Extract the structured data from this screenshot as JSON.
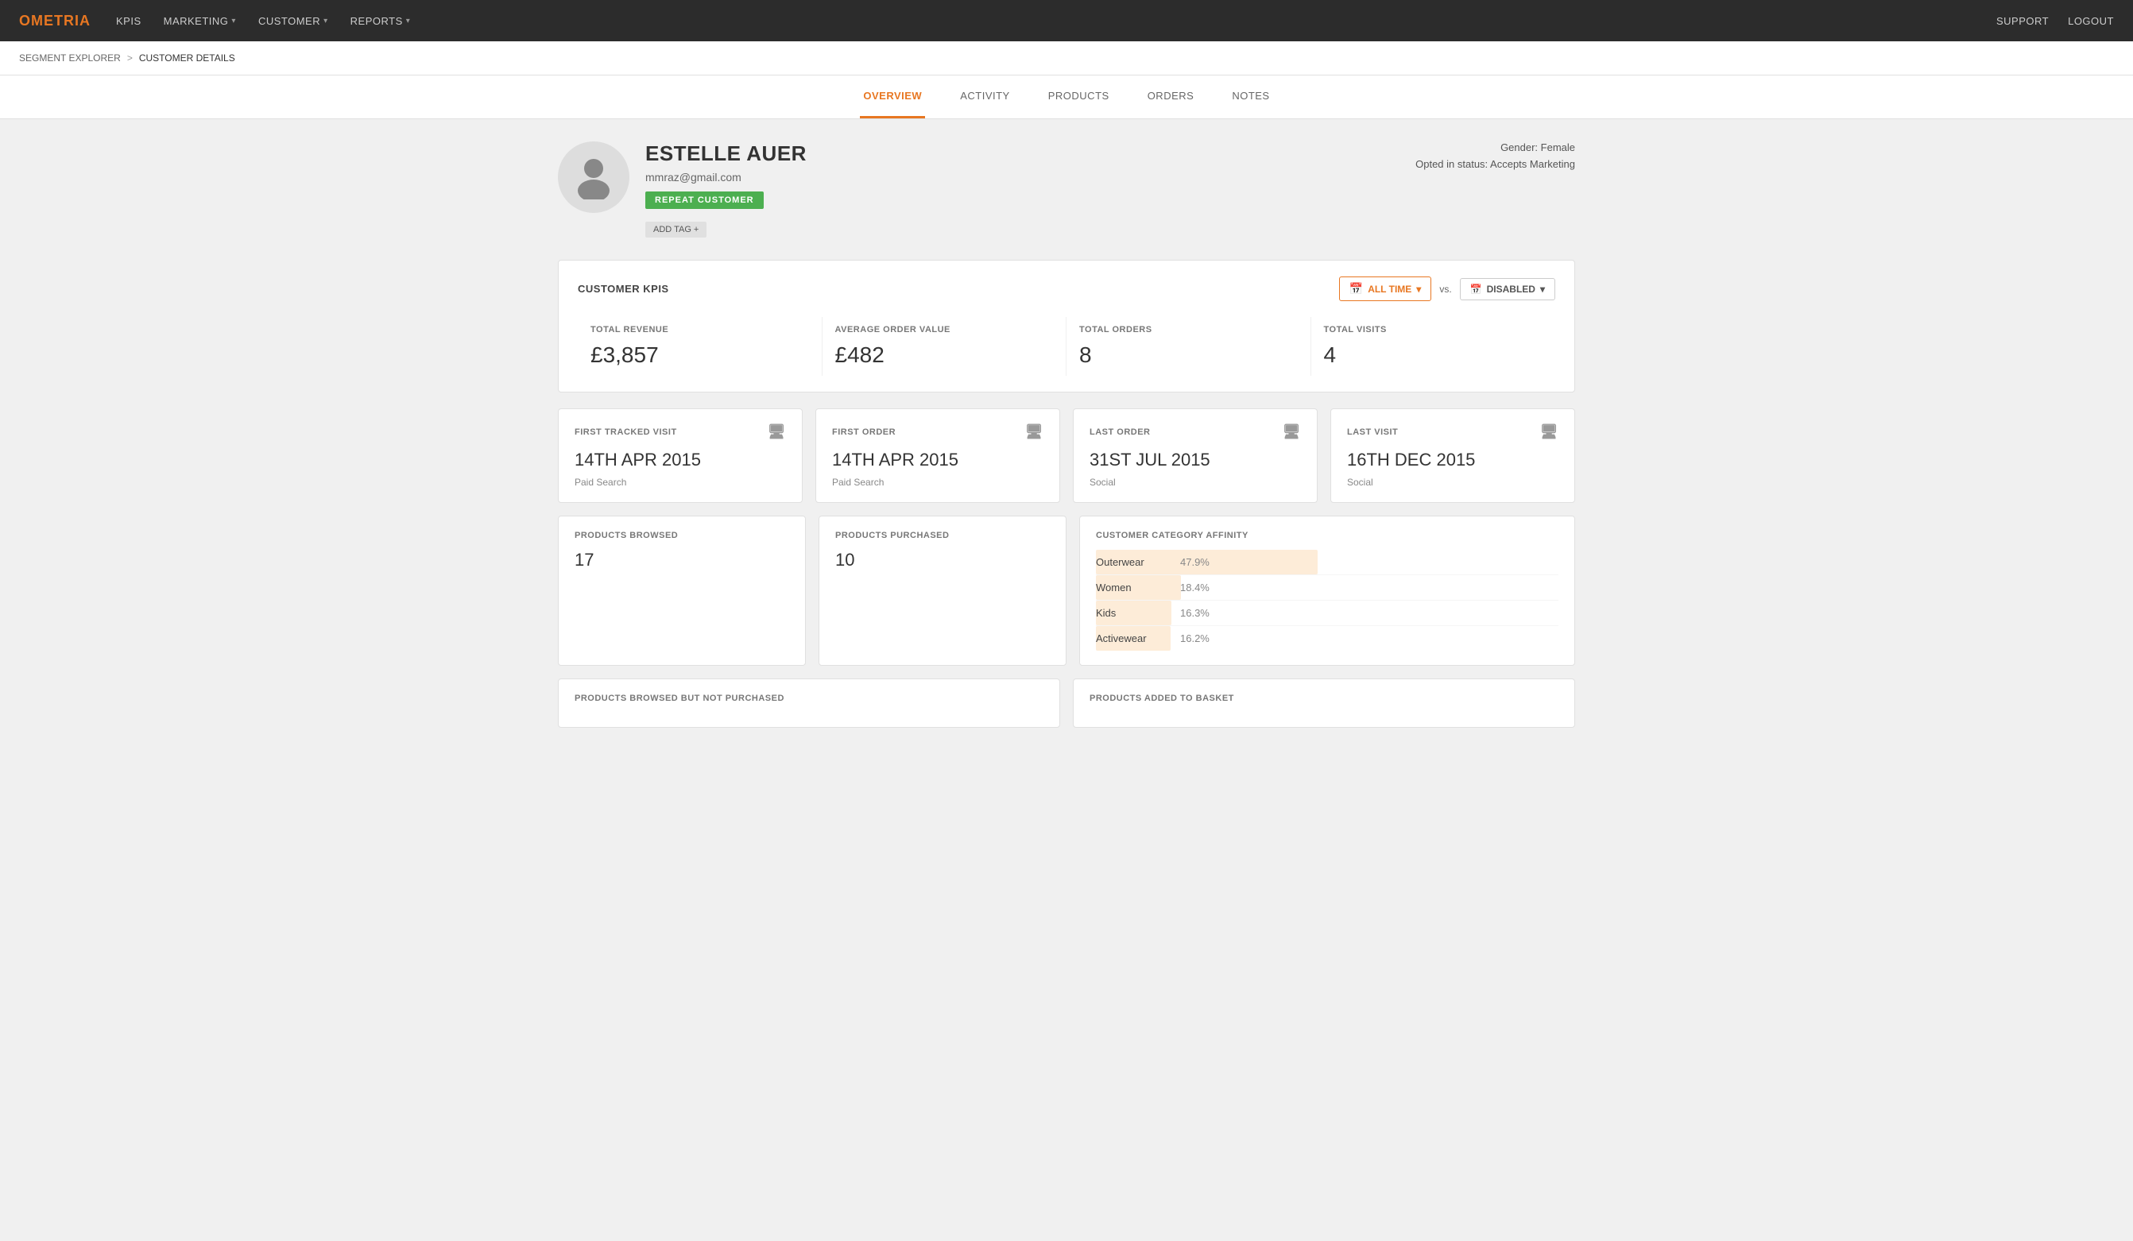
{
  "nav": {
    "logo": "OMETRIA",
    "items": [
      {
        "label": "KPIS",
        "hasDropdown": false
      },
      {
        "label": "MARKETING",
        "hasDropdown": true
      },
      {
        "label": "CUSTOMER",
        "hasDropdown": true
      },
      {
        "label": "REPORTS",
        "hasDropdown": true
      }
    ],
    "right_items": [
      {
        "label": "SUPPORT"
      },
      {
        "label": "LOGOUT"
      }
    ]
  },
  "breadcrumb": {
    "parent": "SEGMENT EXPLORER",
    "separator": ">",
    "current": "CUSTOMER DETAILS"
  },
  "tabs": [
    {
      "label": "OVERVIEW",
      "active": true
    },
    {
      "label": "ACTIVITY",
      "active": false
    },
    {
      "label": "PRODUCTS",
      "active": false
    },
    {
      "label": "ORDERS",
      "active": false
    },
    {
      "label": "NOTES",
      "active": false
    }
  ],
  "customer": {
    "name": "ESTELLE AUER",
    "email": "mmraz@gmail.com",
    "badge": "REPEAT CUSTOMER",
    "add_tag": "ADD TAG +",
    "gender": "Gender: Female",
    "opted_in": "Opted in status: Accepts Marketing"
  },
  "kpis": {
    "title": "CUSTOMER KPIS",
    "time_btn": "ALL TIME",
    "vs_label": "vs.",
    "disabled_btn": "DISABLED",
    "metrics": [
      {
        "label": "TOTAL REVENUE",
        "value": "£3,857"
      },
      {
        "label": "AVERAGE ORDER VALUE",
        "value": "£482"
      },
      {
        "label": "TOTAL ORDERS",
        "value": "8"
      },
      {
        "label": "TOTAL VISITS",
        "value": "4"
      }
    ]
  },
  "visit_cards": [
    {
      "label": "FIRST TRACKED VISIT",
      "value": "14TH APR 2015",
      "sub": "Paid Search"
    },
    {
      "label": "FIRST ORDER",
      "value": "14TH APR 2015",
      "sub": "Paid Search"
    },
    {
      "label": "LAST ORDER",
      "value": "31ST JUL 2015",
      "sub": "Social"
    },
    {
      "label": "LAST VISIT",
      "value": "16TH DEC 2015",
      "sub": "Social"
    }
  ],
  "product_cards": [
    {
      "label": "PRODUCTS BROWSED",
      "value": "17"
    },
    {
      "label": "PRODUCTS PURCHASED",
      "value": "10"
    }
  ],
  "affinity": {
    "title": "CUSTOMER CATEGORY AFFINITY",
    "items": [
      {
        "label": "Outerwear",
        "pct": "47.9%",
        "width": 47.9
      },
      {
        "label": "Women",
        "pct": "18.4%",
        "width": 18.4
      },
      {
        "label": "Kids",
        "pct": "16.3%",
        "width": 16.3
      },
      {
        "label": "Activewear",
        "pct": "16.2%",
        "width": 16.2
      }
    ]
  },
  "bottom_cards": [
    {
      "label": "PRODUCTS BROWSED BUT NOT PURCHASED",
      "value": ""
    },
    {
      "label": "PRODUCTS ADDED TO BASKET",
      "value": ""
    }
  ]
}
